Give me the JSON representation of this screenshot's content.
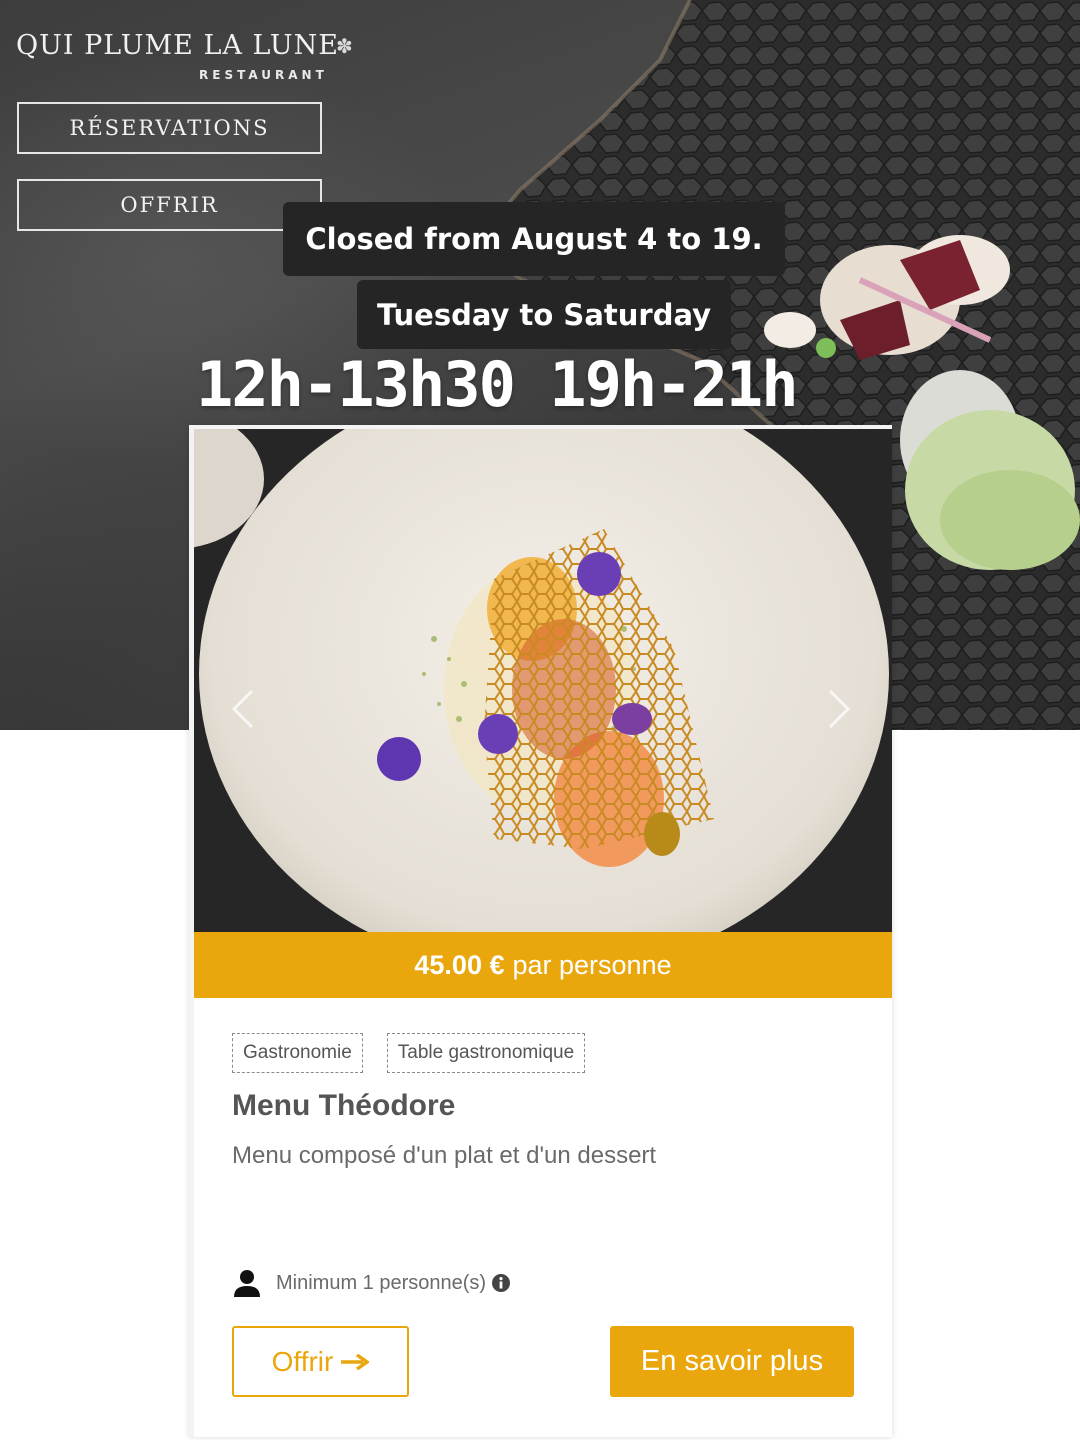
{
  "brand": {
    "name": "QUI PLUME LA LUNE",
    "subtitle": "RESTAURANT",
    "flower_icon": "flower-icon"
  },
  "nav": {
    "reservations_label": "RÉSERVATIONS",
    "offrir_label": "OFFRIR"
  },
  "announcement": {
    "closed": "Closed from August 4 to 19.",
    "days": "Tuesday to Saturday",
    "hours": "12h-13h30 19h-21h"
  },
  "offer": {
    "price": "45.00 €",
    "price_unit": "par personne",
    "tags": [
      "Gastronomie",
      "Table gastronomique"
    ],
    "title": "Menu Théodore",
    "description": "Menu composé d'un plat et d'un dessert",
    "minimum": "Minimum 1 personne(s)",
    "offrir_label": "Offrir",
    "more_label": "En savoir plus"
  },
  "colors": {
    "accent": "#e9a70d",
    "pill_bg": "#252525",
    "text_gray": "#555555"
  },
  "icons": {
    "carousel_prev": "chevron-left-icon",
    "carousel_next": "chevron-right-icon",
    "person": "person-icon",
    "info": "info-icon",
    "arrow": "arrow-right-icon"
  }
}
